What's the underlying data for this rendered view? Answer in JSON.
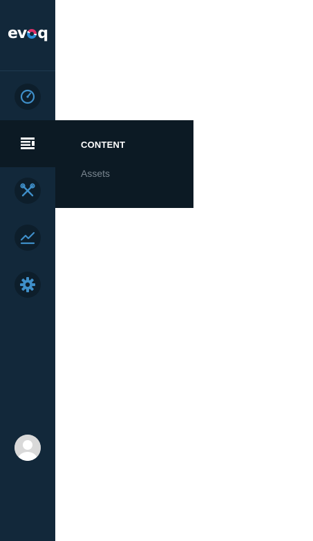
{
  "brand": {
    "logo_text_prefix": "ev",
    "logo_text_suffix": "q"
  },
  "sidebar": {
    "items": [
      {
        "name": "dashboard",
        "icon": "gauge-icon",
        "active": false
      },
      {
        "name": "content",
        "icon": "content-icon",
        "active": true
      },
      {
        "name": "manage",
        "icon": "tools-icon",
        "active": false
      },
      {
        "name": "analytics",
        "icon": "chart-line-icon",
        "active": false
      },
      {
        "name": "settings",
        "icon": "gear-icon",
        "active": false
      }
    ],
    "avatar": {
      "icon": "user-avatar-icon"
    }
  },
  "flyout": {
    "title": "CONTENT",
    "links": [
      {
        "label": "Assets"
      }
    ]
  },
  "colors": {
    "sidebar_bg": "#12283a",
    "active_bg": "#0c1a24",
    "icon_blue": "#3f8fc9",
    "flyout_link": "#7a8690"
  }
}
